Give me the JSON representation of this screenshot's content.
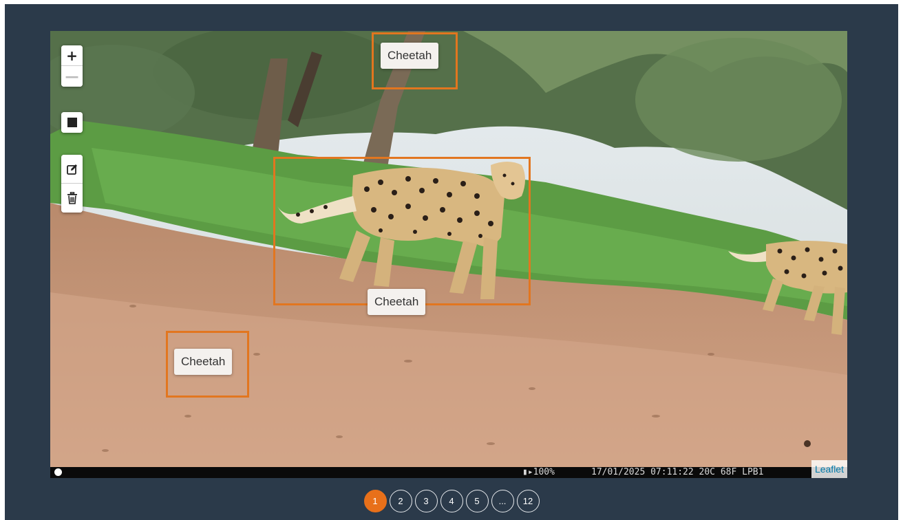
{
  "map": {
    "zoom_in_label": "+",
    "zoom_out_label": "—",
    "draw_rectangle_icon": "square-icon",
    "edit_icon": "edit-icon",
    "delete_icon": "trash-icon",
    "attribution": "Leaflet"
  },
  "annotations": [
    {
      "label": "Cheetah"
    },
    {
      "label": "Cheetah"
    },
    {
      "label": "Cheetah"
    }
  ],
  "camera_strip": {
    "battery": "100%",
    "timestamp": "17/01/2025 07:11:22  20C 68F LPB1"
  },
  "pagination": {
    "pages": [
      "1",
      "2",
      "3",
      "4",
      "5",
      "...",
      "12"
    ],
    "current": "1"
  },
  "colors": {
    "background": "#2b3a4a",
    "accent": "#e8701a",
    "box_border": "#e2761f"
  }
}
